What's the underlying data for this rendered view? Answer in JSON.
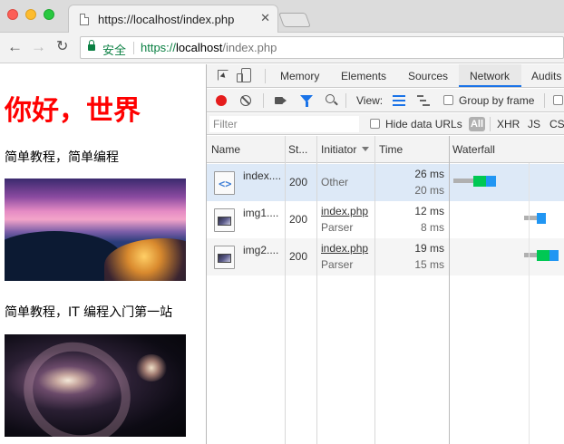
{
  "browser": {
    "tab_title": "https://localhost/index.php",
    "tab_close": "✕",
    "nav_back": "←",
    "nav_forward": "→",
    "nav_reload": "↻",
    "secure_label": "安全",
    "url_scheme": "https://",
    "url_host": "localhost",
    "url_path": "/index.php"
  },
  "page": {
    "heading": "你好，世界",
    "paragraph1": "简单教程，简单编程",
    "paragraph2": "简单教程，IT 编程入门第一站"
  },
  "devtools": {
    "tabs": [
      "Memory",
      "Elements",
      "Sources",
      "Network",
      "Audits"
    ],
    "active_tab": "Network",
    "toolbar": {
      "view_label": "View:",
      "group_by_frame": "Group by frame"
    },
    "filter": {
      "placeholder": "Filter",
      "hide_data_urls": "Hide data URLs",
      "all": "All",
      "types": [
        "XHR",
        "JS",
        "CS"
      ]
    },
    "columns": [
      "Name",
      "St...",
      "Initiator",
      "Time",
      "Waterfall"
    ],
    "rows": [
      {
        "name": "index....",
        "status": "200",
        "initiator": "Other",
        "initiator_sub": "",
        "time": "26 ms",
        "latency": "20 ms",
        "icon": "document-icon"
      },
      {
        "name": "img1....",
        "status": "200",
        "initiator": "index.php",
        "initiator_sub": "Parser",
        "time": "12 ms",
        "latency": "8 ms",
        "icon": "image-icon"
      },
      {
        "name": "img2....",
        "status": "200",
        "initiator": "index.php",
        "initiator_sub": "Parser",
        "time": "19 ms",
        "latency": "15 ms",
        "icon": "image-icon"
      }
    ],
    "colors": {
      "accent": "#1a73e8",
      "record": "#e51c1c",
      "waiting": "#00c853",
      "download": "#2196f3",
      "queued": "#b0b0b0"
    }
  }
}
